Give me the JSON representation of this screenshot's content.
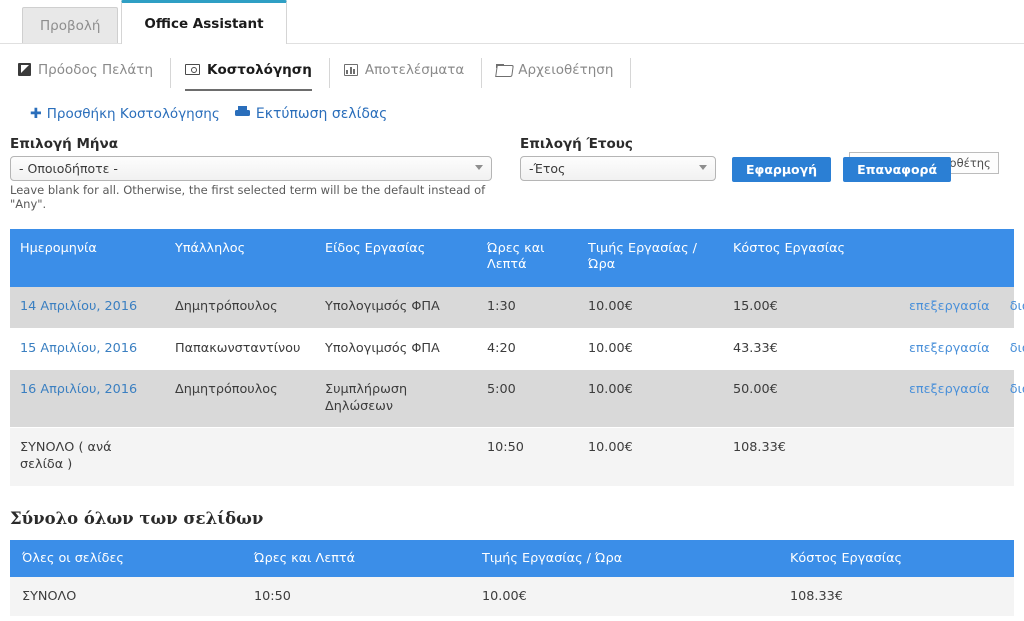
{
  "primary_tabs": [
    {
      "label": "Προβολή",
      "active": false
    },
    {
      "label": "Office Assistant",
      "active": true
    }
  ],
  "secondary_tabs": [
    {
      "label": "Πρόοδος Πελάτη",
      "icon": "arrow-box-icon",
      "active": false
    },
    {
      "label": "Κοστολόγηση",
      "icon": "money-icon",
      "active": true
    },
    {
      "label": "Αποτελέσματα",
      "icon": "bar-chart-icon",
      "active": false
    },
    {
      "label": "Αρχειοθέτηση",
      "icon": "folder-open-icon",
      "active": false
    }
  ],
  "actions": {
    "add_label": "Προσθήκη Κοστολόγησης",
    "print_label": "Εκτύπωση σελίδας"
  },
  "tooltip": {
    "text": "Αριστερός στηλοθέτης"
  },
  "filters": {
    "month_label": "Επιλογή Μήνα",
    "month_value": "- Οποιοδήποτε -",
    "year_label": "Επιλογή Έτους",
    "year_value": "-Έτος",
    "helper_text": "Leave blank for all. Otherwise, the first selected term will be the default instead of \"Any\".",
    "apply_label": "Εφαρμογή",
    "reset_label": "Επαναφορά"
  },
  "main_table": {
    "headers": [
      "Ημερομηνία",
      "Υπάλληλος",
      "Είδος Εργασίας",
      "Ώρες και Λεπτά",
      "Τιμής Εργασίας / Ώρα",
      "Κόστος Εργασίας",
      ""
    ],
    "rows": [
      {
        "date": "14 Απριλίου, 2016",
        "employee": "Δημητρόπουλος",
        "work_type": "Υπολογιμσός ΦΠΑ",
        "hours": "1:30",
        "rate": "10.00€",
        "cost": "15.00€",
        "edit": "επεξεργασία",
        "delete": "διαγραφή"
      },
      {
        "date": "15 Απριλίου, 2016",
        "employee": "Παπακωνσταντίνου",
        "work_type": "Υπολογιμσός ΦΠΑ",
        "hours": "4:20",
        "rate": "10.00€",
        "cost": "43.33€",
        "edit": "επεξεργασία",
        "delete": "διαγραφή"
      },
      {
        "date": "16 Απριλίου, 2016",
        "employee": "Δημητρόπουλος",
        "work_type": "Συμπλήρωση Δηλώσεων",
        "hours": "5:00",
        "rate": "10.00€",
        "cost": "50.00€",
        "edit": "επεξεργασία",
        "delete": "διαγραφή"
      }
    ],
    "total_row": {
      "label": "ΣΥΝΟΛΟ ( ανά σελίδα )",
      "employee": "",
      "work_type": "",
      "hours": "10:50",
      "rate": "10.00€",
      "cost": "108.33€"
    }
  },
  "summary": {
    "title": "Σύνολο όλων των σελίδων",
    "headers": [
      "Όλες οι σελίδες",
      "Ώρες και Λεπτά",
      "Τιμής Εργασίας / Ώρα",
      "Κόστος Εργασίας"
    ],
    "row": {
      "label": "ΣΥΝΟΛΟ",
      "hours": "10:50",
      "rate": "10.00€",
      "cost": "108.33€"
    }
  },
  "colors": {
    "table_header": "#3b8ee8",
    "button": "#2b7fd4",
    "link": "#2a6ebb",
    "active_tab_border": "#2f9fc4"
  }
}
